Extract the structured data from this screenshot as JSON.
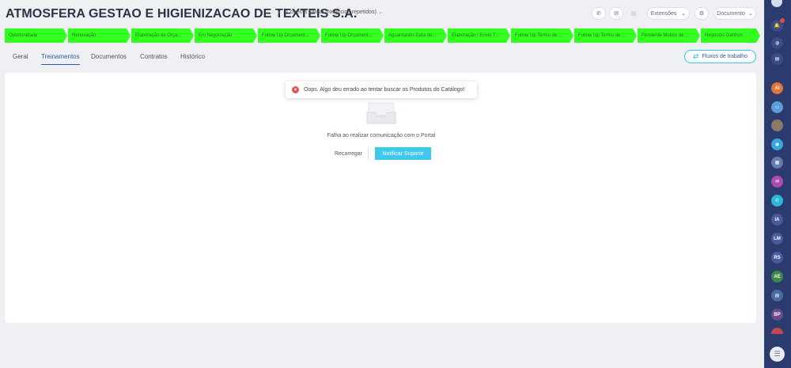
{
  "header": {
    "title": "ATMOSFERA GESTAO E HIGIENIZACAO DE TEXTEIS S.A.",
    "title_tools": "⟋ ⟋",
    "selector": "Conecta Oficial (Negócios repetidos)",
    "buttons": {
      "phone": "✆",
      "mail": "✉",
      "extra": "▤",
      "extensions": "Extensões",
      "settings": "⚙",
      "documents": "Documento"
    }
  },
  "pipeline": {
    "stages": [
      "Oportunidade",
      "Renovação",
      "Elaboração de Orça...",
      "Em Negociação",
      "Follow Up Orçament...",
      "Follow Up Orçament...",
      "Aguardando Data de...",
      "Elaboração / Envio T...",
      "Follow Up Termo de ...",
      "Follow Up Termo de ...",
      "Pendente Motivo de ...",
      "Negócios Ganhos"
    ],
    "color": "#33ff1f"
  },
  "tabs": [
    "Geral",
    "Treinamentos",
    "Documentos",
    "Contratos",
    "Histórico"
  ],
  "active_tab": "Treinamentos",
  "workflow_button": "Fluxos de trabalho",
  "toast": {
    "icon": "×",
    "message": "Oops. Algo deu errado ao tentar buscar os Produtos do Catálogo!"
  },
  "empty_state": {
    "message": "Falha ao realizar comunicação com o Portal",
    "reload_button": "Recarregar",
    "notify_button": "Notificar Suporte"
  },
  "sidebar": {
    "icons": [
      {
        "name": "profile-avatar",
        "label": "",
        "color": "#d8dce8"
      },
      {
        "name": "notifications-icon",
        "label": "🔔",
        "color": "#3a4c86"
      },
      {
        "name": "globe-icon",
        "label": "◍",
        "color": "#3a4c86"
      },
      {
        "name": "list-icon",
        "label": "▤",
        "color": "#3a4c86"
      },
      {
        "name": "ai-icon",
        "label": "AI",
        "color": "#e0763a"
      },
      {
        "name": "chat-icon",
        "label": "▭",
        "color": "#5aa0d8"
      },
      {
        "name": "user-avatar",
        "label": "",
        "color": "#8a7a6a"
      },
      {
        "name": "message-icon",
        "label": "◉",
        "color": "#3aa6e0"
      },
      {
        "name": "calendar-icon",
        "label": "▦",
        "color": "#6a7ab0"
      },
      {
        "name": "mail-icon",
        "label": "✉",
        "color": "#b04ab0"
      },
      {
        "name": "phone-icon",
        "label": "✆",
        "color": "#2bb7d6"
      },
      {
        "name": "user-avatar-ia",
        "label": "IA",
        "color": "#4a5a9a"
      },
      {
        "name": "user-avatar-lm",
        "label": "LM",
        "color": "#4a5a9a"
      },
      {
        "name": "user-avatar-rs",
        "label": "RS",
        "color": "#4a5a9a"
      },
      {
        "name": "user-avatar-ae",
        "label": "AE",
        "color": "#3a8a4a"
      },
      {
        "name": "report-icon",
        "label": "▤",
        "color": "#4a6aa0"
      },
      {
        "name": "user-avatar-bp",
        "label": "BP",
        "color": "#6a4a8a"
      },
      {
        "name": "user-avatar-extra",
        "label": "",
        "color": "#c04a4a"
      },
      {
        "name": "chat-bubble-icon",
        "label": "☰",
        "color": "#e8ebf2"
      }
    ]
  }
}
